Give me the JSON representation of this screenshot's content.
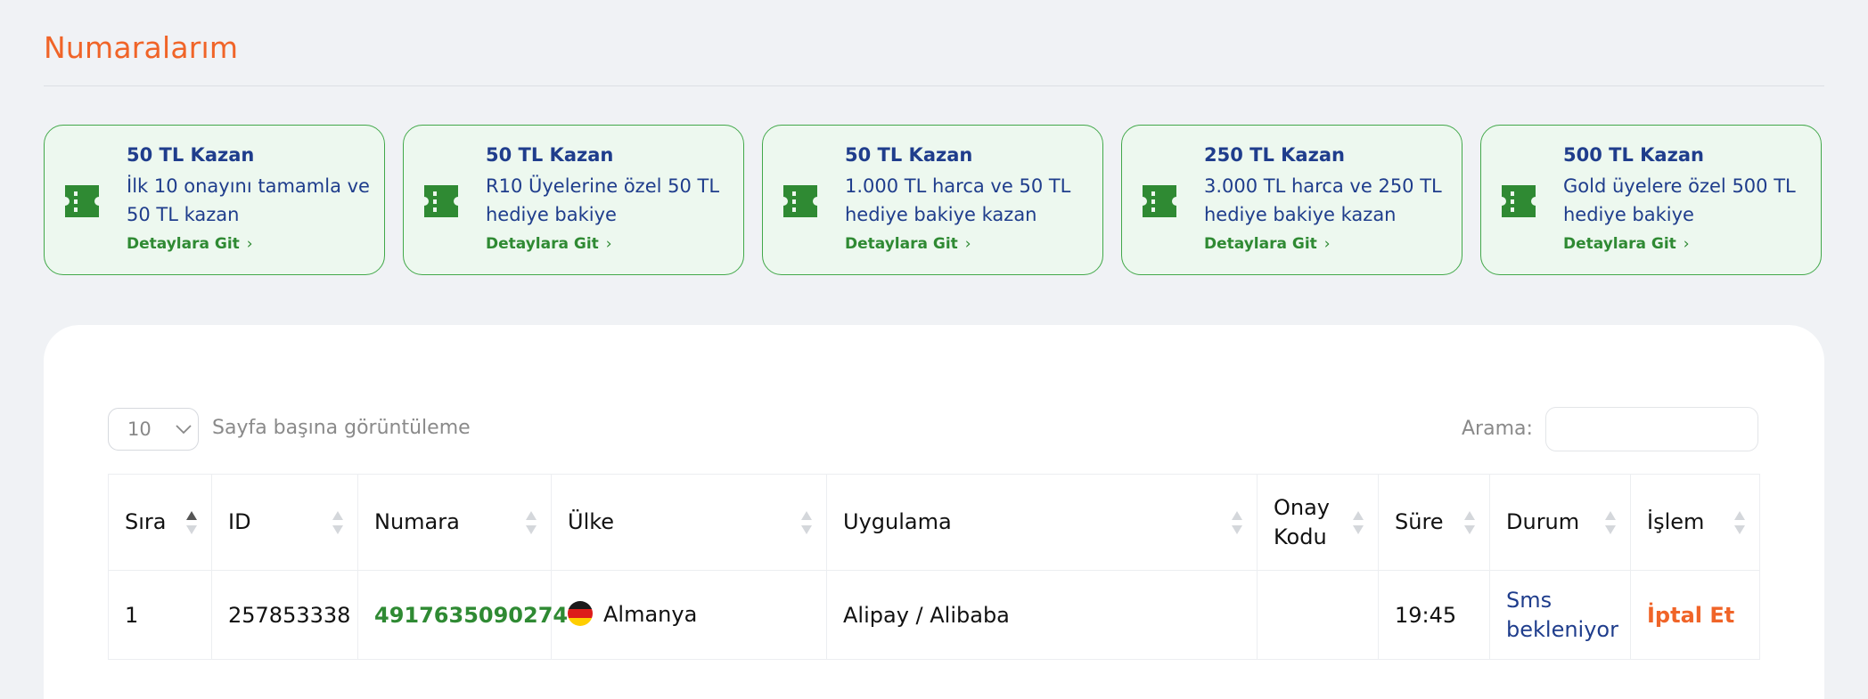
{
  "page": {
    "title": "Numaralarım"
  },
  "promos": [
    {
      "title": "50 TL Kazan",
      "desc": "İlk 10 onayını tamamla ve 50 TL kazan",
      "link": "Detaylara Git"
    },
    {
      "title": "50 TL Kazan",
      "desc": "R10 Üyelerine özel 50 TL hediye bakiye",
      "link": "Detaylara Git"
    },
    {
      "title": "50 TL Kazan",
      "desc": "1.000 TL harca ve 50 TL hediye bakiye kazan",
      "link": "Detaylara Git"
    },
    {
      "title": "250 TL Kazan",
      "desc": "3.000 TL harca ve 250 TL hediye bakiye kazan",
      "link": "Detaylara Git"
    },
    {
      "title": "500 TL Kazan",
      "desc": "Gold üyelere özel 500 TL hediye bakiye",
      "link": "Detaylara Git"
    }
  ],
  "table_controls": {
    "page_length": "10",
    "page_length_label": "Sayfa başına görüntüleme",
    "search_label": "Arama:",
    "search_value": ""
  },
  "table": {
    "columns": [
      "Sıra",
      "ID",
      "Numara",
      "Ülke",
      "Uygulama",
      "Onay Kodu",
      "Süre",
      "Durum",
      "İşlem"
    ],
    "rows": [
      {
        "sira": "1",
        "id": "257853338",
        "numara": "4917635090274",
        "ulke": "Almanya",
        "uygulama": "Alipay / Alibaba",
        "onay_kodu": "",
        "sure": "19:45",
        "durum": "Sms bekleniyor",
        "islem": "İptal Et"
      }
    ]
  },
  "colors": {
    "accent": "#f06428",
    "promo_border": "#42a84a",
    "promo_bg": "#edf8ef",
    "navy": "#1f3d8c",
    "green": "#2f8a33"
  },
  "icons": {
    "promo": "ticket-icon",
    "select": "chevron-down-icon",
    "sort": "sort-icon"
  }
}
